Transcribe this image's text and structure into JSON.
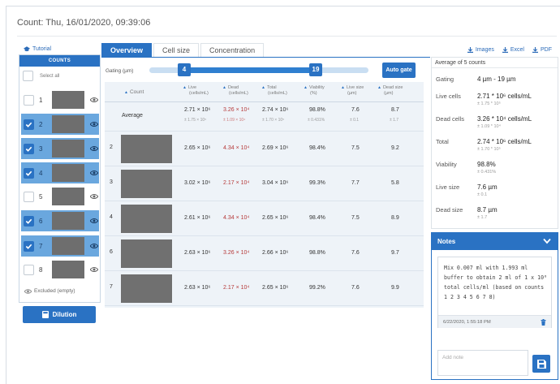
{
  "page": {
    "title": "Count: Thu, 16/01/2020, 09:39:06"
  },
  "left": {
    "tutorial_label": "Tutorial",
    "counts_header": "COUNTS",
    "select_all_label": "Select all",
    "items": [
      {
        "label": "1",
        "checked": false
      },
      {
        "label": "2",
        "checked": true
      },
      {
        "label": "3",
        "checked": true
      },
      {
        "label": "4",
        "checked": true
      },
      {
        "label": "5",
        "checked": false
      },
      {
        "label": "6",
        "checked": true
      },
      {
        "label": "7",
        "checked": true
      },
      {
        "label": "8",
        "checked": false
      }
    ],
    "excluded_label": "Excluded (empty)",
    "dilution_label": "Dilution"
  },
  "tabs": [
    {
      "label": "Overview",
      "active": true
    },
    {
      "label": "Cell size",
      "active": false
    },
    {
      "label": "Concentration",
      "active": false
    }
  ],
  "exports": {
    "images": "Images",
    "excel": "Excel",
    "pdf": "PDF"
  },
  "gating": {
    "label": "Gating (µm)",
    "min": "4",
    "max": "19",
    "autogate_label": "Auto gate"
  },
  "table": {
    "headers": {
      "count": "Count",
      "live": [
        "Live",
        "(cells/mL)"
      ],
      "dead": [
        "Dead",
        "(cells/mL)"
      ],
      "total": [
        "Total",
        "(cells/mL)"
      ],
      "viability": [
        "Viability",
        "(%)"
      ],
      "live_size": [
        "Live size",
        "(µm)"
      ],
      "dead_size": [
        "Dead size",
        "(µm)"
      ]
    },
    "average": {
      "label": "Average",
      "live": "2.71 × 10⁶",
      "live_sd": "± 1.75 × 10⁵",
      "dead": "3.26 × 10⁴",
      "dead_sd": "± 1.09 × 10⁴",
      "total": "2.74 × 10⁶",
      "total_sd": "± 1.70 × 10⁵",
      "viability": "98.8%",
      "viability_sd": "± 0.431%",
      "live_size": "7.6",
      "live_size_sd": "± 0.1",
      "dead_size": "8.7",
      "dead_size_sd": "± 1.7"
    },
    "rows": [
      {
        "count": "2",
        "live": "2.65 × 10⁶",
        "dead": "4.34 × 10⁴",
        "total": "2.69 × 10⁶",
        "viability": "98.4%",
        "live_size": "7.5",
        "dead_size": "9.2"
      },
      {
        "count": "3",
        "live": "3.02 × 10⁶",
        "dead": "2.17 × 10⁴",
        "total": "3.04 × 10⁶",
        "viability": "99.3%",
        "live_size": "7.7",
        "dead_size": "5.8"
      },
      {
        "count": "4",
        "live": "2.61 × 10⁶",
        "dead": "4.34 × 10⁴",
        "total": "2.65 × 10⁶",
        "viability": "98.4%",
        "live_size": "7.5",
        "dead_size": "8.9"
      },
      {
        "count": "6",
        "live": "2.63 × 10⁶",
        "dead": "3.26 × 10⁴",
        "total": "2.66 × 10⁶",
        "viability": "98.8%",
        "live_size": "7.6",
        "dead_size": "9.7"
      },
      {
        "count": "7",
        "live": "2.63 × 10⁶",
        "dead": "2.17 × 10⁴",
        "total": "2.65 × 10⁶",
        "viability": "99.2%",
        "live_size": "7.6",
        "dead_size": "9.9"
      }
    ]
  },
  "summary": {
    "title": "Average of 5 counts",
    "gating_label": "Gating",
    "gating_value": "4 µm - 19 µm",
    "live_label": "Live cells",
    "live_value": "2.71 * 10⁶ cells/mL",
    "live_sd": "± 1.75 * 10⁵",
    "dead_label": "Dead cells",
    "dead_value": "3.26 * 10⁴ cells/mL",
    "dead_sd": "± 1.09 * 10⁴",
    "total_label": "Total",
    "total_value": "2.74 * 10⁶ cells/mL",
    "total_sd": "± 1.70 * 10⁵",
    "viability_label": "Viability",
    "viability_value": "98.8%",
    "viability_sd": "± 0.431%",
    "live_size_label": "Live size",
    "live_size_value": "7.6 µm",
    "live_size_sd": "± 0.1",
    "dead_size_label": "Dead size",
    "dead_size_value": "8.7 µm",
    "dead_size_sd": "± 1.7"
  },
  "notes": {
    "title": "Notes",
    "text": "Mix 0.007 ml with 1.993 ml buffer to obtain 2 ml of 1 x 10⁶ total cells/ml (based on counts  1 2 3 4 5 6 7 8)",
    "timestamp": "6/22/2020, 1:55:18 PM",
    "add_placeholder": "Add note"
  },
  "colors": {
    "accent": "#2a72c3",
    "selected_row": "#6aa7de",
    "dead_text": "#b63a3a"
  }
}
